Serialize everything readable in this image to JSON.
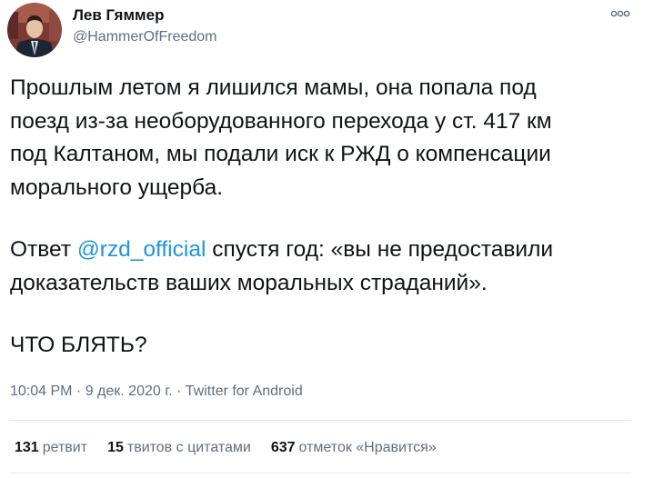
{
  "author": {
    "display_name": "Лев Гяммер",
    "handle": "@HammerOfFreedom",
    "avatar_icon": "profile-photo-avatar"
  },
  "more_icon": "more-options-icon",
  "tweet": {
    "paragraph1": "Прошлым летом я лишился мамы, она попала под\nпоезд из-за необорудованного перехода у ст. 417 км\nпод Калтаном, мы подали иск к РЖД о компенсации\nморального ущерба.",
    "paragraph2_before": "Ответ ",
    "paragraph2_mention": "@rzd_official",
    "paragraph2_after": " спустя год: «вы не предоставили\nдоказательств ваших моральных страданий».",
    "paragraph3": "ЧТО БЛЯТЬ?"
  },
  "meta": {
    "time": "10:04 PM",
    "separator1": " · ",
    "date": "9 дек. 2020 г.",
    "separator2": " · ",
    "source": "Twitter for Android"
  },
  "stats": {
    "retweets_count": "131",
    "retweets_label": "ретвит",
    "quotes_count": "15",
    "quotes_label": "твитов с цитатами",
    "likes_count": "637",
    "likes_label": "отметок «Нравится»"
  },
  "colors": {
    "text": "#0f1419",
    "secondary": "#5b7083",
    "link": "#1b95e0",
    "divider": "#e3e8ec"
  }
}
